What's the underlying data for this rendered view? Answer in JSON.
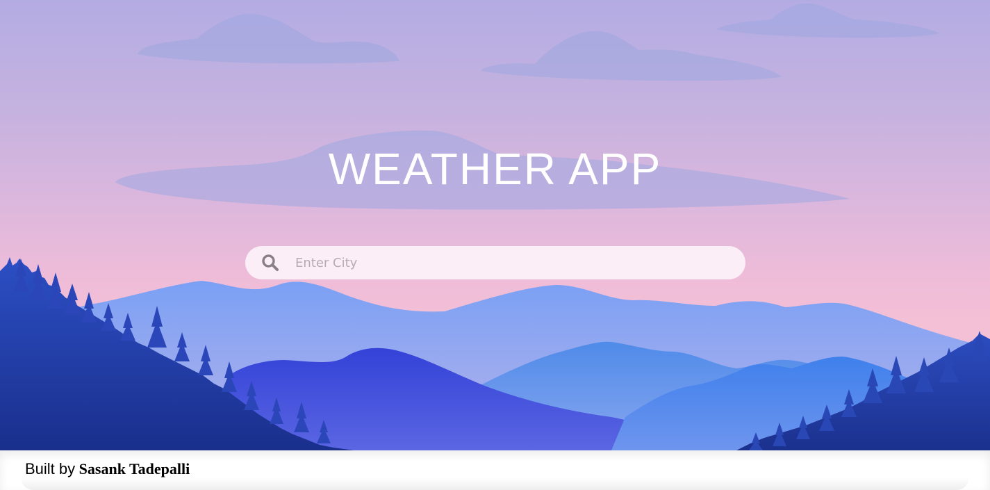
{
  "app": {
    "title": "WEATHER APP"
  },
  "search": {
    "placeholder": "Enter City",
    "value": "",
    "icon": "search-icon"
  },
  "footer": {
    "prefix": "Built by",
    "author": "Sasank Tadepalli"
  },
  "colors": {
    "sky_top": "#b3ace3",
    "sky_bottom": "#f4c0d6",
    "mountain_far": "#7f9ef0",
    "mountain_mid": "#5b86ec",
    "mountain_near": "#3f47d6",
    "forest": "#1f3a9c",
    "title_text": "#ffffff"
  }
}
